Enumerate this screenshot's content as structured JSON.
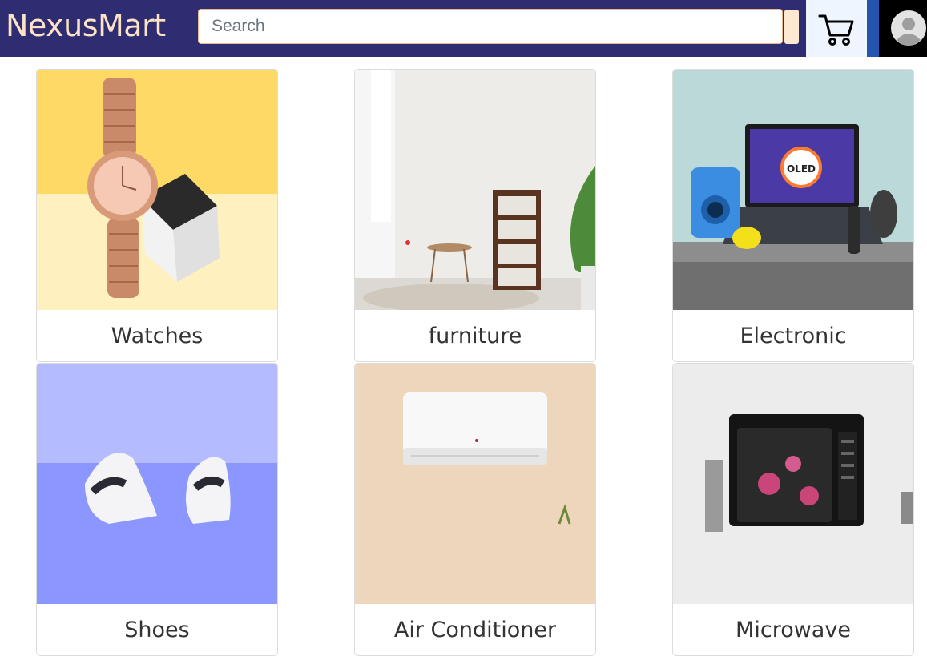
{
  "header": {
    "brand": "NexusMart",
    "search_placeholder": "Search",
    "cart_icon": "cart-icon",
    "profile_icon": "avatar-icon"
  },
  "categories": [
    {
      "label": "Watches"
    },
    {
      "label": "furniture"
    },
    {
      "label": "Electronic"
    },
    {
      "label": "Shoes"
    },
    {
      "label": "Air Conditioner"
    },
    {
      "label": "Microwave"
    }
  ],
  "colors": {
    "navbar": "#2e2d72",
    "brand": "#fde2c6",
    "accent_blue": "#2553b0"
  }
}
